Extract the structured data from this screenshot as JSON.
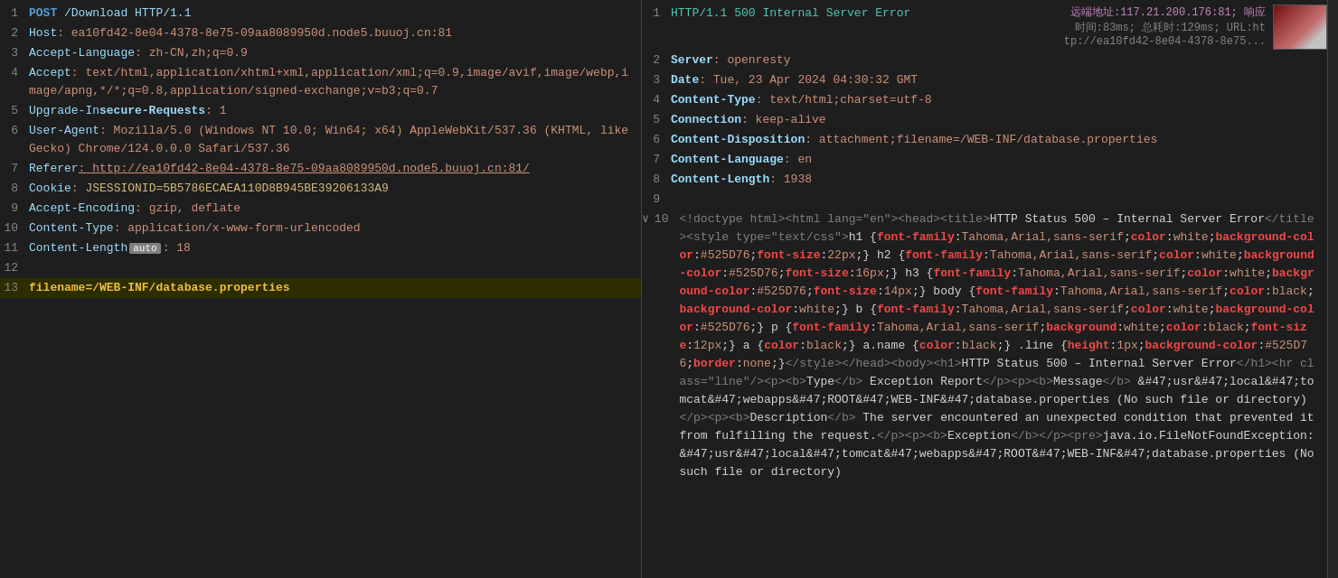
{
  "left": {
    "lines": [
      {
        "num": 1,
        "parts": [
          {
            "text": "POST",
            "cls": "c-method"
          },
          {
            "text": " /Download HTTP/1.1",
            "cls": "c-url"
          }
        ]
      },
      {
        "num": 2,
        "parts": [
          {
            "text": "Host",
            "cls": "c-header-key"
          },
          {
            "text": ": ea10fd42-8e04-4378-8e75-09aa8089950d.node5.buuoj.cn:81",
            "cls": "c-header-val"
          }
        ]
      },
      {
        "num": 3,
        "parts": [
          {
            "text": "Accept-Language",
            "cls": "c-header-key"
          },
          {
            "text": ": zh-CN,zh;q=0.9",
            "cls": "c-header-val"
          }
        ]
      },
      {
        "num": 4,
        "parts": [
          {
            "text": "Accept",
            "cls": "c-header-key"
          },
          {
            "text": ": text/html,application/xhtml+xml,application/xml;q=0.9,image/avif,image/webp,image/apng,*/*;q=0.8,application/signed-exchange;v=b3;q=0.7",
            "cls": "c-header-val"
          }
        ]
      },
      {
        "num": 5,
        "parts": [
          {
            "text": "Upgrade-In",
            "cls": "c-header-key"
          },
          {
            "text": "secure-Requests",
            "cls": "c-header-key-bold"
          },
          {
            "text": ": 1",
            "cls": "c-header-val"
          }
        ]
      },
      {
        "num": 6,
        "parts": [
          {
            "text": "User-Agent",
            "cls": "c-header-key"
          },
          {
            "text": ": Mozilla/5.0 (Windows NT 10.0; Win64; x64) AppleWebKit/537.36 (KHTML, like Gecko) Chrome/124.0.0.0 Safari/537.36",
            "cls": "c-header-val"
          }
        ]
      },
      {
        "num": 7,
        "parts": [
          {
            "text": "Referer",
            "cls": "c-header-key"
          },
          {
            "text": ": http://ea10fd42-8e04-4378-8e75-09aa8089950d.node5.buuoj.cn:81/",
            "cls": "c-header-val c-underline"
          }
        ]
      },
      {
        "num": 8,
        "parts": [
          {
            "text": "Cookie",
            "cls": "c-header-key"
          },
          {
            "text": ": ",
            "cls": "c-header-val"
          },
          {
            "text": "JSESSIONID=5B5786ECAEA110D8B945BE39206133A9",
            "cls": "c-session"
          }
        ]
      },
      {
        "num": 9,
        "parts": [
          {
            "text": "Accept-Encoding",
            "cls": "c-header-key"
          },
          {
            "text": ": gzip, deflate",
            "cls": "c-header-val"
          }
        ]
      },
      {
        "num": 10,
        "parts": [
          {
            "text": "Content-Type",
            "cls": "c-header-key"
          },
          {
            "text": ": application/x-www-form-urlencoded",
            "cls": "c-header-val"
          }
        ]
      },
      {
        "num": 11,
        "parts": [
          {
            "text": "Content-Length",
            "cls": "c-header-key"
          },
          {
            "text": " auto ",
            "cls": "c-auto-badge"
          },
          {
            "text": ": 18",
            "cls": "c-header-val"
          }
        ],
        "auto": true
      },
      {
        "num": 12,
        "parts": []
      },
      {
        "num": 13,
        "parts": [
          {
            "text": "filename=/WEB-INF/database.properties",
            "cls": "c-param-key"
          }
        ],
        "highlight": true
      }
    ]
  },
  "right": {
    "lines": [
      {
        "num": 1,
        "parts": [
          {
            "text": "HTTP/1.1 500 Internal Server Error",
            "cls": "c-status-ok"
          }
        ],
        "meta": true
      },
      {
        "num": 2,
        "parts": [
          {
            "text": "Server",
            "cls": "c-resp-key"
          },
          {
            "text": ": openresty",
            "cls": "c-resp-val"
          }
        ]
      },
      {
        "num": 3,
        "parts": [
          {
            "text": "Date",
            "cls": "c-resp-key"
          },
          {
            "text": ": Tue, 23 Apr 2024 04:30:32 GMT",
            "cls": "c-resp-val"
          }
        ]
      },
      {
        "num": 4,
        "parts": [
          {
            "text": "Content-Type",
            "cls": "c-resp-key-bold"
          },
          {
            "text": ": text/html;charset=utf-8",
            "cls": "c-resp-val"
          }
        ]
      },
      {
        "num": 5,
        "parts": [
          {
            "text": "Connection",
            "cls": "c-resp-key"
          },
          {
            "text": ": keep-alive",
            "cls": "c-resp-val"
          }
        ]
      },
      {
        "num": 6,
        "parts": [
          {
            "text": "Content-Disposition",
            "cls": "c-resp-key"
          },
          {
            "text": ": attachment;filename=/WEB-INF/database.properties",
            "cls": "c-resp-val"
          }
        ]
      },
      {
        "num": 7,
        "parts": [
          {
            "text": "Content-Language",
            "cls": "c-resp-key"
          },
          {
            "text": ": en",
            "cls": "c-resp-val"
          }
        ]
      },
      {
        "num": 8,
        "parts": [
          {
            "text": "Content-Length",
            "cls": "c-resp-key-bold"
          },
          {
            "text": ": 1938",
            "cls": "c-resp-val"
          }
        ]
      },
      {
        "num": 9,
        "parts": []
      },
      {
        "num": 10,
        "parts": [
          {
            "text": "<!doctype html><html lang=\"en\"><head><title>HTTP Status 500 – Internal Server Error</title><style type=\"text/css\">h1 {font-family:Tahoma,Arial,sans-serif;color:white;background-color:#525D76;font-size:22px;} h2 {font-family:Tahoma,Arial,sans-serif;color:white;background-color:#525D76;font-size:16px;} h3 {font-family:Tahoma,Arial,sans-serif;color:white;background-color:#525D76;font-size:14px;} body {font-family:Tahoma,Arial,sans-serif;color:black;background-color:white;} b {font-family:Tahoma,Arial,sans-serif;color:white;background-color:#525D76;} p {font-family:Tahoma,Arial,sans-serif;background:white;color:black;font-size:12px;} a {color:black;} a.name {color:black;} .line {height:1px;background-color:#525D76;border:none;}</style></head><body><h1>HTTP Status 500 – Internal Server Error</h1><hr class=\"line\"/><p><b>Type</b> Exception Report</p><p><b>Message</b> &#47;usr&#47;local&#47;tomcat&#47;webapps&#47;ROOT&#47;WEB-INF&#47;database.properties (No such file or directory)</p><p><b>Description</b> The server encountered an unexpected condition that prevented it from fulfilling the request.</p><p><b>Exception</b></p><pre>java.io.FileNotFoundException: &#47;usr&#47;local&#47;tomcat&#47;webapps&#47;ROOT&#47;WEB-INF&#47;database.properties (No such file or directory)",
            "cls": "c-html-text"
          }
        ],
        "expand": true,
        "long": true
      }
    ],
    "meta": {
      "addr": "远端地址:117.21.200.176:81; 响应",
      "time": "时间:83ms; 总耗时:129ms; URL:ht",
      "url": "tp://ea10fd42-8e04-4378-8e75..."
    }
  }
}
